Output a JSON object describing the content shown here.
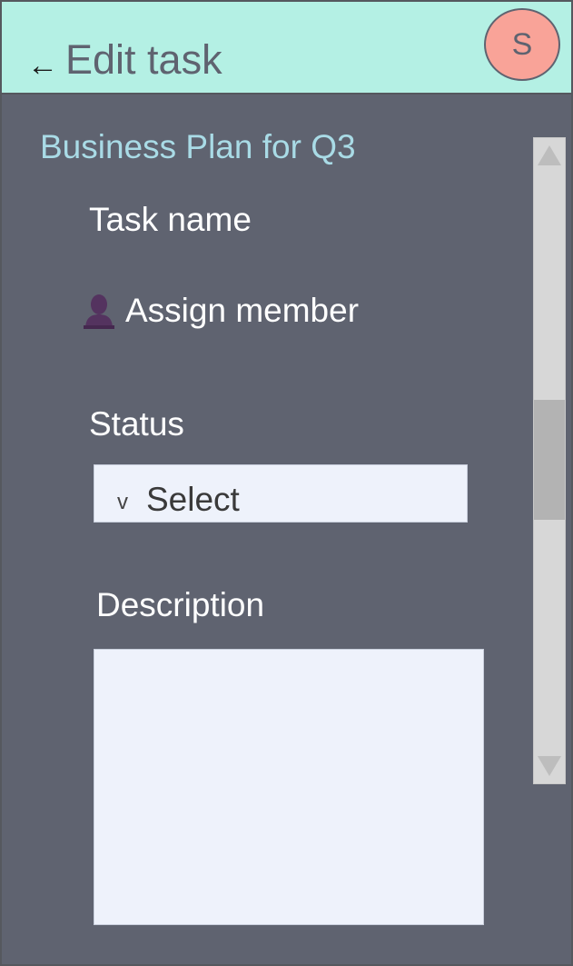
{
  "header": {
    "back_glyph": "←",
    "title": "Edit task",
    "avatar_initial": "S",
    "background_color": "#b4f0e4",
    "avatar_color": "#f9a398"
  },
  "project": {
    "name": "Business Plan for Q3"
  },
  "form": {
    "task_name_label": "Task name",
    "assign_label": "Assign member",
    "assign_icon": "person-icon",
    "status_label": "Status",
    "status_select": {
      "chevron": "v",
      "value": "Select"
    },
    "description_label": "Description",
    "description_value": ""
  },
  "colors": {
    "panel_background": "#5f6370",
    "project_name_color": "#a9dbe6",
    "field_background": "#eef2fb"
  }
}
